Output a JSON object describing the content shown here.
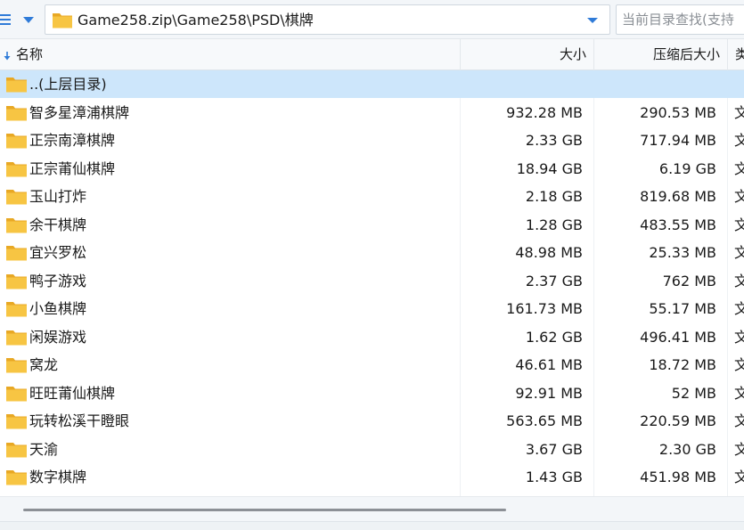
{
  "address_bar": {
    "path": "Game258.zip\\Game258\\PSD\\棋牌",
    "search_placeholder": "当前目录查找(支持"
  },
  "columns": {
    "name": "名称",
    "size": "大小",
    "packed_size": "压缩后大小",
    "type": "类"
  },
  "rows": [
    {
      "name": "..(上层目录)",
      "size": "",
      "packed": "",
      "type": ""
    },
    {
      "name": "智多星漳浦棋牌",
      "size": "932.28 MB",
      "packed": "290.53 MB",
      "type": "文"
    },
    {
      "name": "正宗南漳棋牌",
      "size": "2.33 GB",
      "packed": "717.94 MB",
      "type": "文"
    },
    {
      "name": "正宗莆仙棋牌",
      "size": "18.94 GB",
      "packed": "6.19 GB",
      "type": "文"
    },
    {
      "name": "玉山打炸",
      "size": "2.18 GB",
      "packed": "819.68 MB",
      "type": "文"
    },
    {
      "name": "余干棋牌",
      "size": "1.28 GB",
      "packed": "483.55 MB",
      "type": "文"
    },
    {
      "name": "宜兴罗松",
      "size": "48.98 MB",
      "packed": "25.33 MB",
      "type": "文"
    },
    {
      "name": "鸭子游戏",
      "size": "2.37 GB",
      "packed": "762 MB",
      "type": "文"
    },
    {
      "name": "小鱼棋牌",
      "size": "161.73 MB",
      "packed": "55.17 MB",
      "type": "文"
    },
    {
      "name": "闲娱游戏",
      "size": "1.62 GB",
      "packed": "496.41 MB",
      "type": "文"
    },
    {
      "name": "窝龙",
      "size": "46.61 MB",
      "packed": "18.72 MB",
      "type": "文"
    },
    {
      "name": "旺旺莆仙棋牌",
      "size": "92.91 MB",
      "packed": "52 MB",
      "type": "文"
    },
    {
      "name": "玩转松溪干瞪眼",
      "size": "563.65 MB",
      "packed": "220.59 MB",
      "type": "文"
    },
    {
      "name": "天渝",
      "size": "3.67 GB",
      "packed": "2.30 GB",
      "type": "文"
    },
    {
      "name": "数字棋牌",
      "size": "1.43 GB",
      "packed": "451.98 MB",
      "type": "文"
    }
  ],
  "icons": {
    "menu": "menu-icon",
    "history": "chevron-down-icon",
    "folder": "folder-icon",
    "sort": "sort-arrow-icon"
  },
  "colors": {
    "accent": "#2f7bd8",
    "selected_row": "#cde6fb",
    "folder_yellow": "#f7c543"
  }
}
